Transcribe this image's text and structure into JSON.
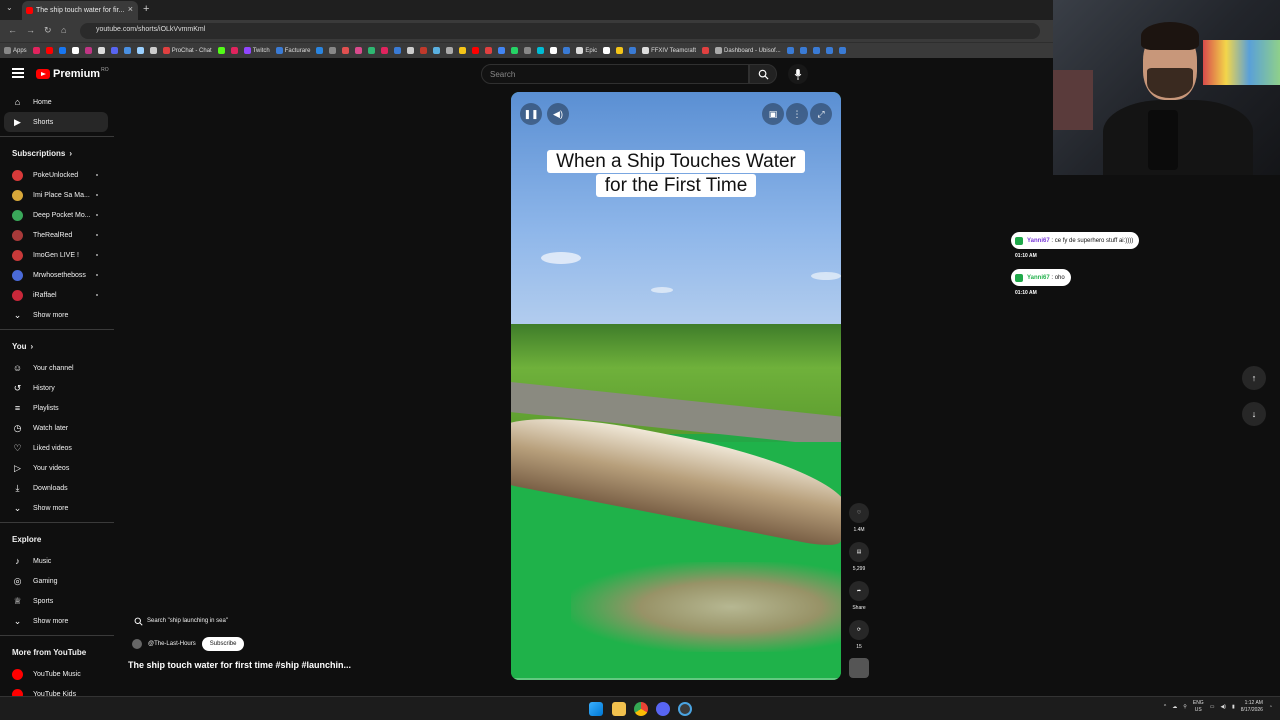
{
  "browser": {
    "tab_title": "The ship touch water for fir...",
    "url": "youtube.com/shorts/iOLkVvmmKml",
    "bookmarks": [
      {
        "label": "Apps",
        "color": "#888888"
      },
      {
        "label": "",
        "color": "#e0245e"
      },
      {
        "label": "",
        "color": "#ff0000"
      },
      {
        "label": "",
        "color": "#1877f2"
      },
      {
        "label": "",
        "color": "#ffffff"
      },
      {
        "label": "",
        "color": "#c13584"
      },
      {
        "label": "",
        "color": "#dddddd"
      },
      {
        "label": "",
        "color": "#5865f2"
      },
      {
        "label": "",
        "color": "#4a90e2"
      },
      {
        "label": "",
        "color": "#9ad0ff"
      },
      {
        "label": "",
        "color": "#cccccc"
      },
      {
        "label": "ProChat - Chat",
        "color": "#e04040"
      },
      {
        "label": "",
        "color": "#53fc18"
      },
      {
        "label": "",
        "color": "#e0245e"
      },
      {
        "label": "Twitch",
        "color": "#9146ff"
      },
      {
        "label": "Facturare",
        "color": "#3a7bd5"
      },
      {
        "label": "",
        "color": "#2a85e0"
      },
      {
        "label": "",
        "color": "#888888"
      },
      {
        "label": "",
        "color": "#e05050"
      },
      {
        "label": "",
        "color": "#d94a8c"
      },
      {
        "label": "",
        "color": "#2eb872"
      },
      {
        "label": "",
        "color": "#e0245e"
      },
      {
        "label": "",
        "color": "#3a7bd5"
      },
      {
        "label": "",
        "color": "#cccccc"
      },
      {
        "label": "",
        "color": "#c0392b"
      },
      {
        "label": "",
        "color": "#5ab0e0"
      },
      {
        "label": "",
        "color": "#aaaaaa"
      },
      {
        "label": "",
        "color": "#f5c518"
      },
      {
        "label": "",
        "color": "#ff0000"
      },
      {
        "label": "",
        "color": "#e04040"
      },
      {
        "label": "",
        "color": "#4285f4"
      },
      {
        "label": "",
        "color": "#25d366"
      },
      {
        "label": "",
        "color": "#888888"
      },
      {
        "label": "",
        "color": "#00bcd4"
      },
      {
        "label": "",
        "color": "#ffffff"
      },
      {
        "label": "",
        "color": "#3a7bd5"
      },
      {
        "label": "Epic",
        "color": "#dddddd"
      },
      {
        "label": "",
        "color": "#ffffff"
      },
      {
        "label": "",
        "color": "#f5c518"
      },
      {
        "label": "",
        "color": "#3a7bd5"
      },
      {
        "label": "FFXIV Teamcraft",
        "color": "#dddddd"
      },
      {
        "label": "",
        "color": "#e04040"
      },
      {
        "label": "Dashboard - Ubisof...",
        "color": "#aaaaaa"
      },
      {
        "label": "",
        "color": "#3a7bd5"
      },
      {
        "label": "",
        "color": "#3a7bd5"
      },
      {
        "label": "",
        "color": "#3a7bd5"
      },
      {
        "label": "",
        "color": "#3a7bd5"
      },
      {
        "label": "",
        "color": "#3a7bd5"
      }
    ]
  },
  "header": {
    "logo_text": "Premium",
    "logo_sup": "RO",
    "search_placeholder": "Search"
  },
  "sidebar": {
    "main": [
      {
        "label": "Home",
        "icon": "home-icon",
        "glyph": "⌂"
      },
      {
        "label": "Shorts",
        "icon": "shorts-icon",
        "glyph": "▶",
        "active": true
      }
    ],
    "subscriptions_title": "Subscriptions",
    "subscriptions": [
      {
        "label": "PokeUnlocked",
        "color": "#d83a3a"
      },
      {
        "label": "Imi Place Sa Ma...",
        "color": "#d8a83a"
      },
      {
        "label": "Deep Pocket Mo...",
        "color": "#3aa85a"
      },
      {
        "label": "TheRealRed",
        "color": "#a83a3a"
      },
      {
        "label": "ImoGen LIVE !",
        "color": "#c83a3a"
      },
      {
        "label": "Mrwhosetheboss",
        "color": "#4a6ad8"
      },
      {
        "label": "iRaffael",
        "color": "#c8283a"
      }
    ],
    "show_more": "Show more",
    "you_title": "You",
    "you": [
      {
        "label": "Your channel",
        "icon": "your-channel-icon",
        "glyph": "☺"
      },
      {
        "label": "History",
        "icon": "history-icon",
        "glyph": "↺"
      },
      {
        "label": "Playlists",
        "icon": "playlists-icon",
        "glyph": "≡"
      },
      {
        "label": "Watch later",
        "icon": "watch-later-icon",
        "glyph": "◷"
      },
      {
        "label": "Liked videos",
        "icon": "liked-videos-icon",
        "glyph": "♡"
      },
      {
        "label": "Your videos",
        "icon": "your-videos-icon",
        "glyph": "▷"
      },
      {
        "label": "Downloads",
        "icon": "downloads-icon",
        "glyph": "⤓"
      }
    ],
    "explore_title": "Explore",
    "explore": [
      {
        "label": "Music",
        "icon": "music-icon",
        "glyph": "♪"
      },
      {
        "label": "Gaming",
        "icon": "gaming-icon",
        "glyph": "◎"
      },
      {
        "label": "Sports",
        "icon": "sports-icon",
        "glyph": "♕"
      }
    ],
    "more_title": "More from YouTube",
    "more": [
      {
        "label": "YouTube Music",
        "color": "#ff0000"
      },
      {
        "label": "YouTube Kids",
        "color": "#ff0000"
      }
    ]
  },
  "video": {
    "overlay_title": "When a Ship Touches Water for the First Time",
    "progress": 0.0
  },
  "actions": {
    "likes": "1.4M",
    "comments": "5,299",
    "share": "Share",
    "remix": "15"
  },
  "below": {
    "search_suggestion": "Search \"ship launching in sea\"",
    "channel": "@The-Last-Hours",
    "subscribe": "Subscribe",
    "title": "The ship touch water for first time #ship #launchin..."
  },
  "chat": [
    {
      "user": "Yanni67",
      "text": " : ce fy de superhero stuff ai:))))",
      "time": "01:10 AM",
      "user_color": "#7a3ad8"
    },
    {
      "user": "Yanni67",
      "text": " : oho",
      "time": "01:10 AM",
      "user_color": "#22b14c"
    }
  ],
  "taskbar": {
    "lang": "ENG",
    "region": "US",
    "time": "1:12 AM",
    "date": "8/17/2026"
  }
}
